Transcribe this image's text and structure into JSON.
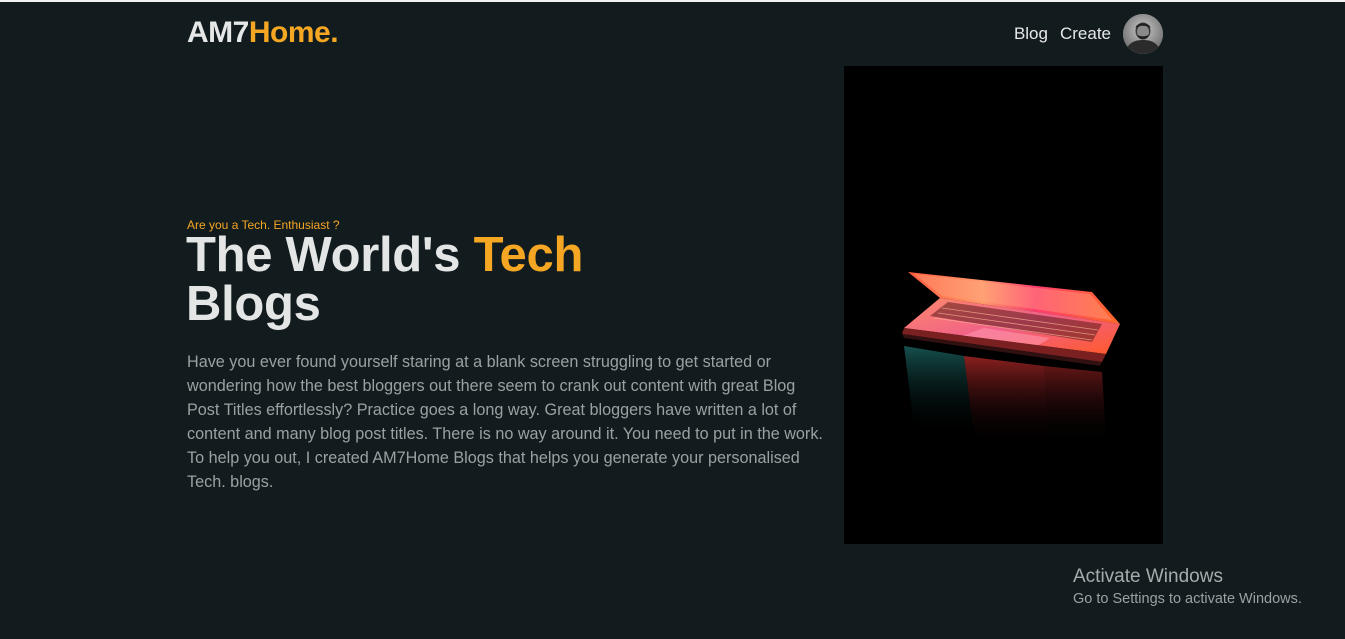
{
  "header": {
    "logo_main": "AM7",
    "logo_accent": "Home.",
    "nav": {
      "blog_label": "Blog",
      "create_label": "Create"
    }
  },
  "hero": {
    "tagline": "Are you a Tech. Enthusiast ?",
    "headline_part1": "The World's ",
    "headline_accent": "Tech",
    "headline_part2": "Blogs",
    "description": "Have you ever found yourself staring at a blank screen struggling to get started or wondering how the best bloggers out there seem to crank out content with great Blog Post Titles effortlessly? Practice goes a long way. Great bloggers have written a lot of content and many blog post titles. There is no way around it. You need to put in the work. To help you out, I created AM7Home Blogs that helps you generate your personalised Tech. blogs.",
    "image_icon": "laptop-photo"
  },
  "watermark": {
    "title": "Activate Windows",
    "subtitle": "Go to Settings to activate Windows."
  },
  "colors": {
    "background": "#121c1e",
    "accent": "#f5a623",
    "heading": "#e4e6e6",
    "body_text": "#9aa1a3"
  }
}
